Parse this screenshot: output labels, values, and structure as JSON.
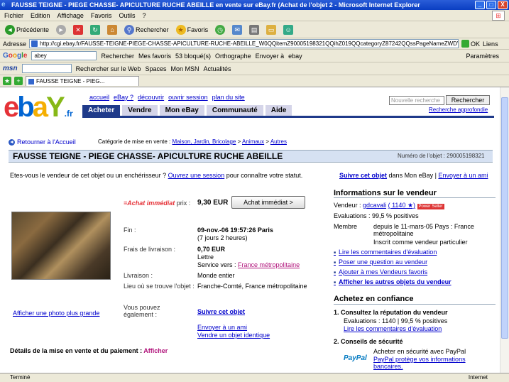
{
  "window": {
    "title": "FAUSSE TEIGNE - PIEGE CHASSE- APICULTURE RUCHE ABEILLE en vente sur eBay.fr (Achat de l'objet 2 - Microsoft Internet Explorer",
    "buttons": {
      "minimize": "_",
      "maximize": "□",
      "close": "X"
    }
  },
  "menu": [
    "Fichier",
    "Edition",
    "Affichage",
    "Favoris",
    "Outils",
    "?"
  ],
  "toolbar": {
    "back": "Précédente",
    "search": "Rechercher",
    "favorites": "Favoris"
  },
  "address": {
    "label": "Adresse",
    "url": "http://cgi.ebay.fr/FAUSSE-TEIGNE-PIEGE-CHASSE-APICULTURE-RUCHE-ABEILLE_W0QQitemZ90005198321QQihZ019QQcategoryZ87242QQssPageNameZWDVWQQrdZ1QQcmdZViewItem",
    "go": "OK",
    "links": "Liens"
  },
  "google": {
    "logo": [
      "G",
      "o",
      "o",
      "g",
      "l",
      "e"
    ],
    "query": "abey",
    "items": [
      "Rechercher",
      "Mes favoris",
      "53 bloqué(s)",
      "Orthographe",
      "Envoyer à",
      "ebay"
    ],
    "settings": "Paramètres"
  },
  "msn": {
    "logo": "msn",
    "items": [
      "Rechercher sur le Web",
      "Spaces",
      "Mon MSN",
      "Actualités"
    ]
  },
  "tab": {
    "label": "FAUSSE TEIGNE - PIEG..."
  },
  "ebay": {
    "logo": {
      "e": "e",
      "b": "b",
      "a": "a",
      "y": "Y",
      "fr": ".fr"
    },
    "toplinks": [
      "accueil",
      "eBay ?",
      "découvrir",
      "ouvrir session",
      "plan du site"
    ],
    "nav": [
      "Acheter",
      "Vendre",
      "Mon eBay",
      "Communauté",
      "Aide"
    ],
    "search_placeholder": "Nouvelle recherche",
    "search_button": "Rechercher",
    "advanced_search": "Recherche approfondie",
    "back": "Retourner à l'Accueil",
    "crumb_prefix": "Catégorie de mise en vente :",
    "crumbs": [
      "Maison, Jardin, Bricolage",
      "Animaux",
      "Autres"
    ],
    "item_title": "FAUSSE TEIGNE - PIEGE CHASSE- APICULTURE RUCHE ABEILLE",
    "item_number": "Numéro de l'objet : 290005198321",
    "seller_question": "Etes-vous le vendeur de cet objet ou un enchérisseur ?",
    "open_session": "Ouvrez une session",
    "seller_question_end": "pour connaître votre statut.",
    "follow": "Suivre cet objet",
    "follow_suffix": "dans Mon eBay",
    "email_friend": "Envoyer à un ami",
    "photo_link": "Afficher une photo plus grande",
    "buy_now_logo": "=Achat immédiat",
    "buy_now_label": "prix :",
    "price": "9,30 EUR",
    "buy_button": "Achat immédiat >",
    "end_label": "Fin :",
    "end_value": "09-nov.-06 19:57:26 Paris",
    "end_remaining": "(7 jours 2 heures)",
    "shipping_label": "Frais de livraison :",
    "shipping_value": "0,70 EUR",
    "shipping_type": "Lettre",
    "shipping_to_label": "Service vers :",
    "shipping_to": "France métropolitaine",
    "delivery_label": "Livraison :",
    "delivery_value": "Monde entier",
    "location_label": "Lieu où se trouve l'objet :",
    "location_value": "Franche-Comté, France métropolitaine",
    "you_can_label": "Vous pouvez également :",
    "you_can": [
      "Suivre cet objet",
      "Envoyer à un ami",
      "Vendre un objet identique"
    ],
    "details": "Détails de la mise en vente et du paiement :",
    "details_link": "Afficher",
    "seller_info_title": "Informations sur le vendeur",
    "seller_label": "Vendeur :",
    "seller_name": "gdcavali",
    "seller_score": "( 1140 ★)",
    "power_seller": "Power Seller",
    "evaluations": "Evaluations : 99,5 % positives",
    "member_label": "Membre",
    "member_value": "depuis le 11-mars-05 Pays : France métropolitaine",
    "registered": "Inscrit comme vendeur particulier",
    "seller_links": [
      "Lire les commentaires d'évaluation",
      "Poser une question au vendeur",
      "Ajouter à mes Vendeurs favoris",
      "Afficher les autres objets du vendeur"
    ],
    "trust_title": "Achetez en confiance",
    "trust1_title": "1. Consultez la réputation du vendeur",
    "trust1_score": "Evaluations : 1140 | 99,5 % positives",
    "trust1_link": "Lire les commentaires d'évaluation",
    "trust2_title": "2. Conseils de sécurité",
    "paypal_logo": [
      "Pay",
      "Pal"
    ],
    "paypal_text": "Acheter en sécurité avec PayPal",
    "paypal_link": "PayPal protège vos informations bancaires."
  },
  "status": {
    "left": "Terminé",
    "right": "Internet"
  }
}
